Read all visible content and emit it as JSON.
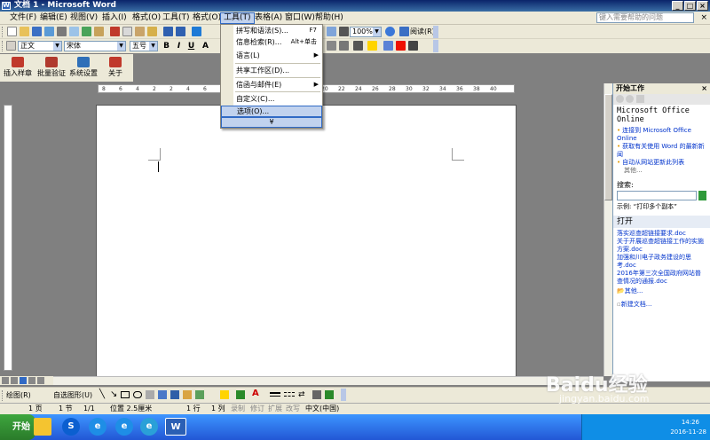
{
  "window": {
    "title": "文档 1 - Microsoft Word",
    "help_placeholder": "键入需要帮助的问题",
    "min": "_",
    "max": "□",
    "close": "×"
  },
  "menubar": [
    {
      "label": "文件(F)"
    },
    {
      "label": "编辑(E)"
    },
    {
      "label": "视图(V)"
    },
    {
      "label": "插入(I)"
    },
    {
      "label": "格式(O)"
    },
    {
      "label": "工具(T)"
    },
    {
      "label": "格式(O)"
    },
    {
      "label": "工具(T)"
    },
    {
      "label": "表格(A)"
    },
    {
      "label": "窗口(W)"
    },
    {
      "label": "帮助(H)"
    }
  ],
  "toolbar": {
    "zoom": "100%",
    "read": "阅读(R)",
    "style": "正文",
    "font": "宋体",
    "size": "五号",
    "bold": "B",
    "italic": "I",
    "underline": "U",
    "font_a": "A"
  },
  "custom_toolbar": [
    {
      "label": "插入样章"
    },
    {
      "label": "批量验证"
    },
    {
      "label": "系统设置"
    },
    {
      "label": "关于"
    }
  ],
  "dropdown": {
    "items": [
      {
        "label": "拼写和语法(S)...",
        "shortcut": "F7"
      },
      {
        "label": "信息检索(R)...",
        "shortcut": "Alt+单击"
      },
      {
        "label": "语言(L)",
        "submenu": "▶"
      },
      {
        "label": "共享工作区(D)..."
      },
      {
        "label": "信函与邮件(E)",
        "submenu": "▶"
      },
      {
        "label": "自定义(C)..."
      },
      {
        "label": "选项(O)..."
      }
    ],
    "more": "¥"
  },
  "ruler": {
    "numbers": [
      "8",
      "6",
      "4",
      "2",
      "2",
      "4",
      "6",
      "8",
      "10",
      "12",
      "14",
      "16",
      "18",
      "20",
      "22",
      "24",
      "26",
      "28",
      "30",
      "32",
      "34",
      "36",
      "38",
      "40"
    ]
  },
  "taskpane": {
    "title": "开始工作",
    "office_online": "Microsoft Office Online",
    "links": [
      "连接到 Microsoft Office Online",
      "获取有关使用 Word 的最新新闻",
      "自动从网站更新此列表"
    ],
    "other": "其他...",
    "search_label": "搜索:",
    "example": "示例: “打印多个副本”",
    "open_title": "打开",
    "recent": [
      "落实巡查超链接要求.doc",
      "关于开展巡查超链接工作的实施方案.doc",
      "加强和川电子政务建设的思考.doc",
      "2016年第三次全国政府网站普查情况的通报.doc"
    ],
    "open_more": "其他...",
    "new_doc": "新建文档..."
  },
  "drawbar": {
    "draw": "绘图(R)",
    "autoshapes": "自选图形(U)"
  },
  "status": {
    "page": "1 页",
    "section": "1 节",
    "pos": "1/1",
    "at": "位置 2.5厘米",
    "line": "1 行",
    "col": "1 列",
    "rec": "录制",
    "trk": "修订",
    "ext": "扩展",
    "ovr": "改写",
    "lang": "中文(中国)"
  },
  "taskbar": {
    "start": "开始",
    "time": "14:26",
    "date": "2016-11-28"
  },
  "watermark": {
    "brand": "Baidu经验",
    "url": "jingyan.baidu.com"
  },
  "colors": {
    "title_bar": "#0a246a",
    "menu_highlight": "#c1d2ee",
    "menu_border": "#316ac5",
    "link": "#0033cc",
    "taskbar": "#2257d5"
  }
}
